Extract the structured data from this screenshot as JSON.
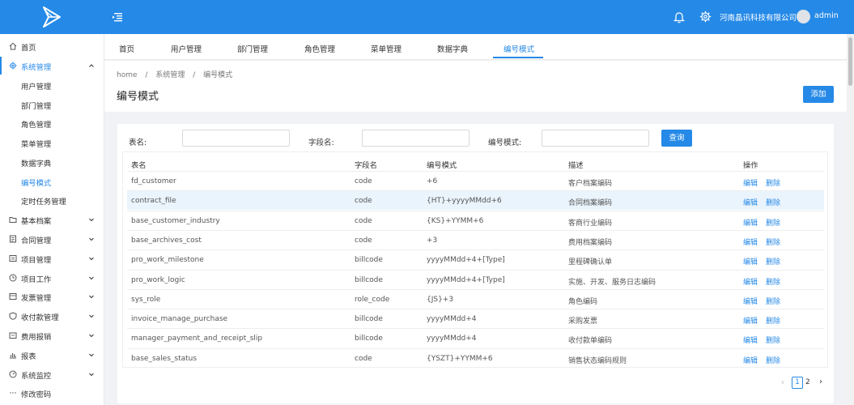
{
  "header": {
    "company": "河南晶讯科技有限公司",
    "username": "admin",
    "color": "#2589e7"
  },
  "sidebar": {
    "items": [
      {
        "label": "首页",
        "icon": "home-icon"
      },
      {
        "label": "系统管理",
        "icon": "gear-icon",
        "expanded": true
      },
      {
        "label": "用户管理"
      },
      {
        "label": "部门管理"
      },
      {
        "label": "角色管理"
      },
      {
        "label": "菜单管理"
      },
      {
        "label": "数据字典"
      },
      {
        "label": "编号模式",
        "active": true
      },
      {
        "label": "定时任务管理"
      },
      {
        "label": "基本档案",
        "icon": "folder-icon"
      },
      {
        "label": "合同管理",
        "icon": "contract-icon"
      },
      {
        "label": "项目管理",
        "icon": "project-icon"
      },
      {
        "label": "项目工作",
        "icon": "clock-icon"
      },
      {
        "label": "发票管理",
        "icon": "invoice-icon"
      },
      {
        "label": "收付款管理",
        "icon": "payment-icon"
      },
      {
        "label": "费用报销",
        "icon": "expense-icon"
      },
      {
        "label": "报表",
        "icon": "chart-icon"
      },
      {
        "label": "系统监控",
        "icon": "monitor-icon"
      },
      {
        "label": "修改密码",
        "icon": "dots-icon"
      }
    ]
  },
  "tabs": [
    "首页",
    "用户管理",
    "部门管理",
    "角色管理",
    "菜单管理",
    "数据字典",
    "编号模式"
  ],
  "active_tab": "编号模式",
  "breadcrumb": [
    "home",
    "/",
    "系统管理",
    "/",
    "编号模式"
  ],
  "page": {
    "title": "编号模式",
    "add_label": "添加"
  },
  "filters": {
    "table_label": "表名:",
    "field_label": "字段名:",
    "pattern_label": "编号模式:",
    "table_value": "",
    "field_value": "",
    "pattern_value": "",
    "query_label": "查询"
  },
  "table": {
    "columns": [
      "表名",
      "字段名",
      "编号模式",
      "描述",
      "操作"
    ],
    "rows": [
      {
        "table": "fd_customer",
        "field": "code",
        "pattern": "+6",
        "desc": "客户档案编码"
      },
      {
        "table": "contract_file",
        "field": "code",
        "pattern": "{HT}+yyyyMMdd+6",
        "desc": "合同档案编码"
      },
      {
        "table": "base_customer_industry",
        "field": "code",
        "pattern": "{KS}+YYMM+6",
        "desc": "客商行业编码"
      },
      {
        "table": "base_archives_cost",
        "field": "code",
        "pattern": "+3",
        "desc": "费用档案编码"
      },
      {
        "table": "pro_work_milestone",
        "field": "billcode",
        "pattern": "yyyyMMdd+4+[Type]",
        "desc": "里程碑确认单"
      },
      {
        "table": "pro_work_logic",
        "field": "billcode",
        "pattern": "yyyyMMdd+4+[Type]",
        "desc": "实施、开发、服务日志编码"
      },
      {
        "table": "sys_role",
        "field": "role_code",
        "pattern": "{JS}+3",
        "desc": "角色编码"
      },
      {
        "table": "invoice_manage_purchase",
        "field": "billcode",
        "pattern": "yyyyMMdd+4",
        "desc": "采购发票"
      },
      {
        "table": "manager_payment_and_receipt_slip",
        "field": "billcode",
        "pattern": "yyyyMMdd+4",
        "desc": "收付款单编码"
      },
      {
        "table": "base_sales_status",
        "field": "code",
        "pattern": "{YSZT}+YYMM+6",
        "desc": "销售状态编码规则"
      }
    ],
    "edit_label": "编辑",
    "delete_label": "删除",
    "highlighted_row": 1
  },
  "pagination": {
    "prev": "‹",
    "pages": [
      "1",
      "2"
    ],
    "current": "1",
    "next": "›"
  }
}
